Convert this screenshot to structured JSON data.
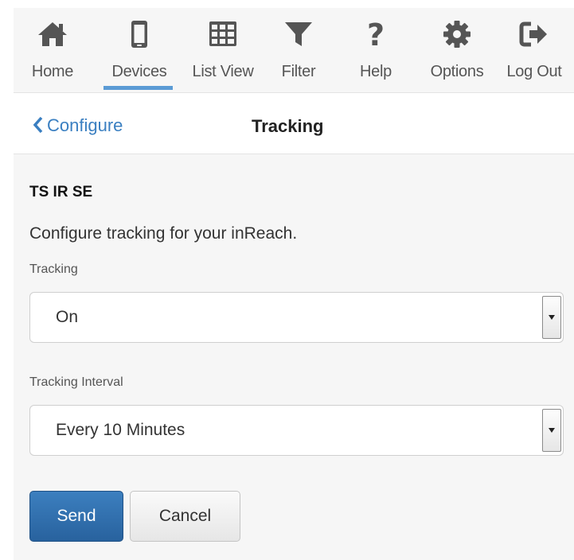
{
  "nav": {
    "items": [
      {
        "label": "Home",
        "icon": "home-icon"
      },
      {
        "label": "Devices",
        "icon": "mobile-device-icon",
        "active": true
      },
      {
        "label": "List View",
        "icon": "grid-table-icon"
      },
      {
        "label": "Filter",
        "icon": "filter-funnel-icon"
      },
      {
        "label": "Help",
        "icon": "question-mark-icon"
      },
      {
        "label": "Options",
        "icon": "gear-icon"
      },
      {
        "label": "Log Out",
        "icon": "logout-icon"
      }
    ],
    "icon_color": "#555555",
    "active_underline_color": "#5b9bd5"
  },
  "header": {
    "back_label": "Configure",
    "title": "Tracking"
  },
  "device_name": "TS IR SE",
  "intro_text": "Configure tracking for your inReach.",
  "fields": {
    "tracking": {
      "label": "Tracking",
      "value": "On"
    },
    "interval": {
      "label": "Tracking Interval",
      "value": "Every 10 Minutes"
    }
  },
  "actions": {
    "send_label": "Send",
    "cancel_label": "Cancel"
  },
  "colors": {
    "link": "#3a7fc1",
    "primary_button": "#2e6da4"
  }
}
